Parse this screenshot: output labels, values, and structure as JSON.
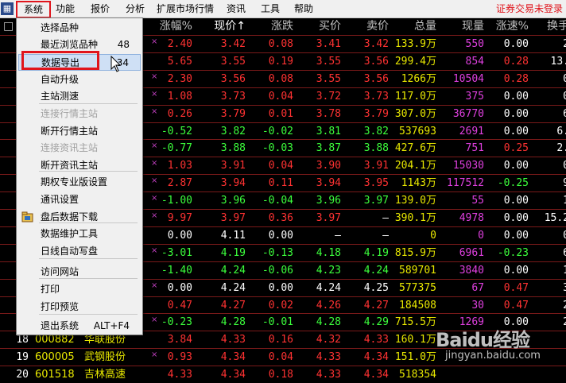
{
  "menubar": {
    "app_icon": "app-logo-icon",
    "items": [
      "系统",
      "功能",
      "报价",
      "分析",
      "扩展市场行情",
      "资讯",
      "工具",
      "帮助"
    ],
    "status": "证券交易未登录"
  },
  "headers": [
    "涨幅%",
    "现价↑",
    "涨跌",
    "买价",
    "卖价",
    "总量",
    "现量",
    "涨速%",
    "换手"
  ],
  "rows": [
    {
      "mark": "×",
      "pct": "2.40",
      "price": "3.42",
      "chg": "0.08",
      "bid": "3.41",
      "ask": "3.42",
      "vol": "133.9万",
      "cur": "550",
      "spd": "0.00",
      "turn": "2",
      "c": "r"
    },
    {
      "mark": "",
      "pct": "5.65",
      "price": "3.55",
      "chg": "0.19",
      "bid": "3.55",
      "ask": "3.56",
      "vol": "299.4万",
      "cur": "854",
      "spd": "0.28",
      "turn": "13.",
      "c": "r"
    },
    {
      "mark": "×",
      "pct": "2.30",
      "price": "3.56",
      "chg": "0.08",
      "bid": "3.55",
      "ask": "3.56",
      "vol": "1266万",
      "cur": "10504",
      "spd": "0.28",
      "turn": "0",
      "c": "r"
    },
    {
      "mark": "×",
      "pct": "1.08",
      "price": "3.73",
      "chg": "0.04",
      "bid": "3.72",
      "ask": "3.73",
      "vol": "117.0万",
      "cur": "375",
      "spd": "0.00",
      "turn": "0",
      "c": "r"
    },
    {
      "mark": "×",
      "pct": "0.26",
      "price": "3.79",
      "chg": "0.01",
      "bid": "3.78",
      "ask": "3.79",
      "vol": "307.0万",
      "cur": "36770",
      "spd": "0.00",
      "turn": "6",
      "c": "r"
    },
    {
      "mark": "",
      "pct": "-0.52",
      "price": "3.82",
      "chg": "-0.02",
      "bid": "3.81",
      "ask": "3.82",
      "vol": "537693",
      "cur": "2691",
      "spd": "0.00",
      "turn": "6.",
      "c": "g"
    },
    {
      "mark": "×",
      "pct": "-0.77",
      "price": "3.88",
      "chg": "-0.03",
      "bid": "3.87",
      "ask": "3.88",
      "vol": "427.6万",
      "cur": "751",
      "spd": "0.25",
      "turn": "2.",
      "c": "g"
    },
    {
      "mark": "×",
      "pct": "1.03",
      "price": "3.91",
      "chg": "0.04",
      "bid": "3.90",
      "ask": "3.91",
      "vol": "204.1万",
      "cur": "15030",
      "spd": "0.00",
      "turn": "0",
      "c": "r"
    },
    {
      "mark": "×",
      "pct": "2.87",
      "price": "3.94",
      "chg": "0.11",
      "bid": "3.94",
      "ask": "3.95",
      "vol": "1143万",
      "cur": "117512",
      "spd": "-0.25",
      "turn": "9",
      "c": "r"
    },
    {
      "mark": "×",
      "pct": "-1.00",
      "price": "3.96",
      "chg": "-0.04",
      "bid": "3.96",
      "ask": "3.97",
      "vol": "139.0万",
      "cur": "55",
      "spd": "0.00",
      "turn": "1",
      "c": "g"
    },
    {
      "mark": "×",
      "pct": "9.97",
      "price": "3.97",
      "chg": "0.36",
      "bid": "3.97",
      "ask": "—",
      "vol": "390.1万",
      "cur": "4978",
      "spd": "0.00",
      "turn": "15.2",
      "c": "r"
    },
    {
      "mark": "",
      "pct": "0.00",
      "price": "4.11",
      "chg": "0.00",
      "bid": "—",
      "ask": "—",
      "vol": "0",
      "cur": "0",
      "spd": "0.00",
      "turn": "0",
      "c": "w"
    },
    {
      "mark": "×",
      "pct": "-3.01",
      "price": "4.19",
      "chg": "-0.13",
      "bid": "4.18",
      "ask": "4.19",
      "vol": "815.9万",
      "cur": "6961",
      "spd": "-0.23",
      "turn": "6",
      "c": "g"
    },
    {
      "mark": "",
      "pct": "-1.40",
      "price": "4.24",
      "chg": "-0.06",
      "bid": "4.23",
      "ask": "4.24",
      "vol": "589701",
      "cur": "3840",
      "spd": "0.00",
      "turn": "1",
      "c": "g"
    },
    {
      "mark": "×",
      "pct": "0.00",
      "price": "4.24",
      "chg": "0.00",
      "bid": "4.24",
      "ask": "4.25",
      "vol": "577375",
      "cur": "67",
      "spd": "0.47",
      "turn": "3",
      "c": "w"
    },
    {
      "mark": "",
      "pct": "0.47",
      "price": "4.27",
      "chg": "0.02",
      "bid": "4.26",
      "ask": "4.27",
      "vol": "184508",
      "cur": "30",
      "spd": "0.47",
      "turn": "2",
      "c": "r"
    },
    {
      "mark": "×",
      "pct": "-0.23",
      "price": "4.28",
      "chg": "-0.01",
      "bid": "4.28",
      "ask": "4.29",
      "vol": "715.5万",
      "cur": "1269",
      "spd": "0.00",
      "turn": "2",
      "c": "g"
    },
    {
      "num": "18",
      "code": "000882",
      "name": "华联股份",
      "mark": "",
      "pct": "3.84",
      "price": "4.33",
      "chg": "0.16",
      "bid": "4.32",
      "ask": "4.33",
      "vol": "160.1万",
      "cur": "",
      "spd": "",
      "turn": "",
      "c": "r"
    },
    {
      "num": "19",
      "code": "600005",
      "name": "武钢股份",
      "mark": "×",
      "pct": "0.93",
      "price": "4.34",
      "chg": "0.04",
      "bid": "4.33",
      "ask": "4.34",
      "vol": "151.0万",
      "cur": "",
      "spd": "",
      "turn": "",
      "c": "r"
    },
    {
      "num": "20",
      "code": "601518",
      "name": "吉林高速",
      "mark": "",
      "pct": "4.33",
      "price": "4.34",
      "chg": "0.18",
      "bid": "4.33",
      "ask": "4.34",
      "vol": "518354",
      "cur": "",
      "spd": "",
      "turn": "",
      "c": "r"
    }
  ],
  "menu": [
    {
      "label": "选择品种",
      "shortcut": "",
      "state": "normal"
    },
    {
      "label": "最近浏览品种",
      "shortcut": "48",
      "state": "normal"
    },
    {
      "label": "数据导出",
      "shortcut": "34",
      "state": "highlight"
    },
    {
      "label": "自动升级",
      "shortcut": "",
      "state": "normal"
    },
    {
      "label": "主站测速",
      "shortcut": "",
      "state": "normal"
    },
    {
      "label": "连接行情主站",
      "shortcut": "",
      "state": "disabled"
    },
    {
      "label": "断开行情主站",
      "shortcut": "",
      "state": "normal"
    },
    {
      "label": "连接资讯主站",
      "shortcut": "",
      "state": "disabled"
    },
    {
      "label": "断开资讯主站",
      "shortcut": "",
      "state": "normal"
    },
    {
      "label": "期权专业版设置",
      "shortcut": "",
      "state": "normal"
    },
    {
      "label": "通讯设置",
      "shortcut": "",
      "state": "normal"
    },
    {
      "label": "盘后数据下载",
      "shortcut": "",
      "state": "normal",
      "icon": "download-data-icon"
    },
    {
      "label": "数据维护工具",
      "shortcut": "",
      "state": "normal"
    },
    {
      "label": "日线自动写盘",
      "shortcut": "",
      "state": "normal"
    },
    {
      "label": "访问网站",
      "shortcut": "",
      "state": "normal"
    },
    {
      "label": "打印",
      "shortcut": "",
      "state": "normal"
    },
    {
      "label": "打印预览",
      "shortcut": "",
      "state": "normal"
    },
    {
      "label": "退出系统",
      "shortcut": "ALT+F4",
      "state": "normal"
    }
  ],
  "watermark": {
    "main": "Baidu经验",
    "sub": "jingyan.baidu.com"
  },
  "colors": {
    "up": "#ff3232",
    "down": "#3cff3c",
    "flat": "#ffffff",
    "yellow": "#e8e800",
    "magenta": "#e040e0",
    "header": "#c0c0c0",
    "highlight_box": "#e0151c"
  }
}
